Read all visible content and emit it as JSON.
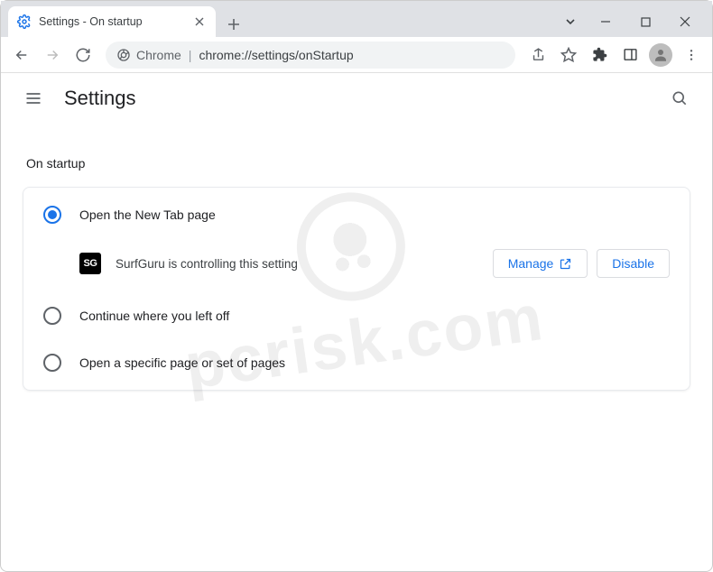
{
  "tab": {
    "title": "Settings - On startup"
  },
  "omnibox": {
    "scheme_label": "Chrome",
    "url": "chrome://settings/onStartup"
  },
  "header": {
    "title": "Settings"
  },
  "section": {
    "title": "On startup"
  },
  "options": {
    "new_tab": "Open the New Tab page",
    "continue": "Continue where you left off",
    "specific": "Open a specific page or set of pages"
  },
  "extension": {
    "icon_text": "SG",
    "message": "SurfGuru is controlling this setting",
    "manage_label": "Manage",
    "disable_label": "Disable"
  },
  "watermark": {
    "text": "pcrisk.com"
  }
}
